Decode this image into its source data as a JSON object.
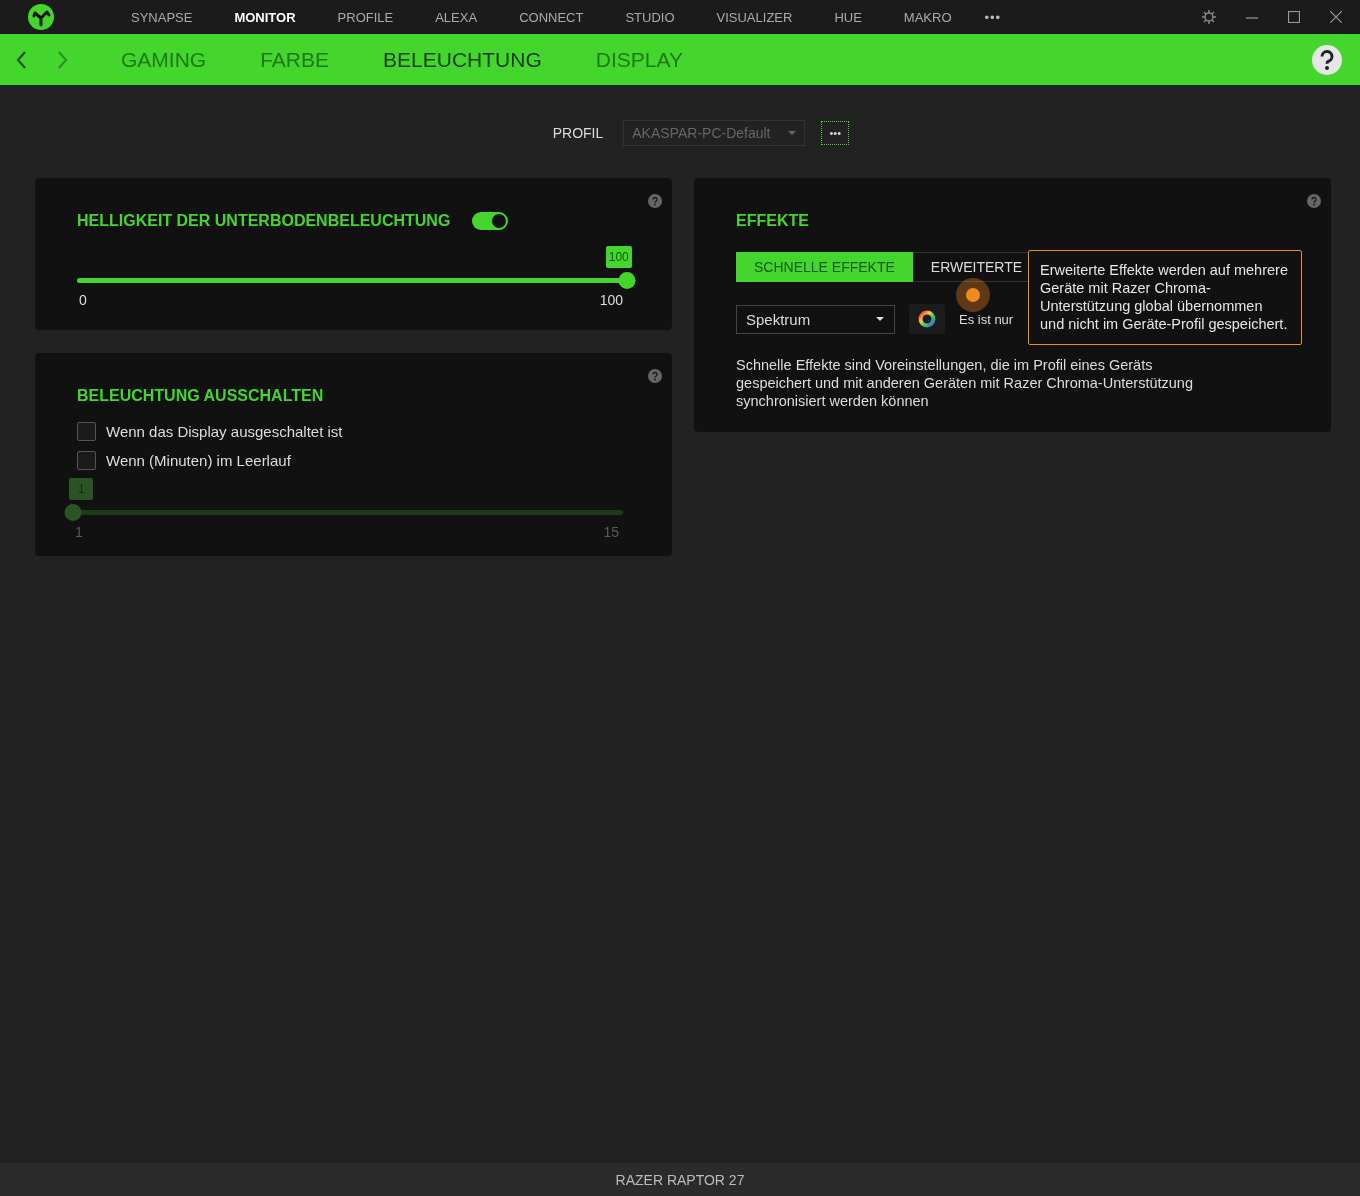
{
  "nav": {
    "items": [
      {
        "label": "SYNAPSE",
        "selected": false
      },
      {
        "label": "MONITOR",
        "selected": true
      },
      {
        "label": "PROFILE",
        "selected": false
      },
      {
        "label": "ALEXA",
        "selected": false
      },
      {
        "label": "CONNECT",
        "selected": false
      },
      {
        "label": "STUDIO",
        "selected": false
      },
      {
        "label": "VISUALIZER",
        "selected": false
      },
      {
        "label": "HUE",
        "selected": false
      },
      {
        "label": "MAKRO",
        "selected": false
      }
    ],
    "more": "•••"
  },
  "subnav": {
    "tabs": [
      {
        "label": "GAMING",
        "selected": false
      },
      {
        "label": "FARBE",
        "selected": false
      },
      {
        "label": "BELEUCHTUNG",
        "selected": true
      },
      {
        "label": "DISPLAY",
        "selected": false
      }
    ]
  },
  "profile": {
    "label": "PROFIL",
    "value": "AKASPAR-PC-Default",
    "more": "•••"
  },
  "brightness": {
    "title": "HELLIGKEIT DER UNTERBODENBELEUCHTUNG",
    "on": true,
    "slider": {
      "level": 1,
      "value": "100",
      "min": "0",
      "max": "100",
      "disabled": false
    }
  },
  "lighting_off": {
    "title": "BELEUCHTUNG AUSSCHALTEN",
    "options": [
      {
        "label": "Wenn das Display ausgeschaltet ist",
        "checked": false
      },
      {
        "label": "Wenn (Minuten) im Leerlauf",
        "checked": false
      }
    ],
    "slider": {
      "level": 0,
      "value": "1",
      "min": "1",
      "max": "15",
      "disabled": true
    }
  },
  "effects": {
    "title": "EFFEKTE",
    "tabs": [
      {
        "label": "SCHNELLE EFFEKTE",
        "selected": true
      },
      {
        "label": "ERWEITERTE",
        "selected": false
      }
    ],
    "effect": "Spektrum",
    "note": "Es ist nur",
    "description": "Schnelle Effekte sind Voreinstellungen, die im Profil eines Geräts gespeichert und mit anderen Geräten mit Razer Chroma-Unterstützung synchronisiert werden können",
    "tooltip": "Erweiterte Effekte werden auf mehrere Geräte mit Razer Chroma-Unterstützung global übernommen und nicht im Geräte-Profil gespeichert."
  },
  "status_bar": {
    "device": "RAZER RAPTOR 27"
  }
}
